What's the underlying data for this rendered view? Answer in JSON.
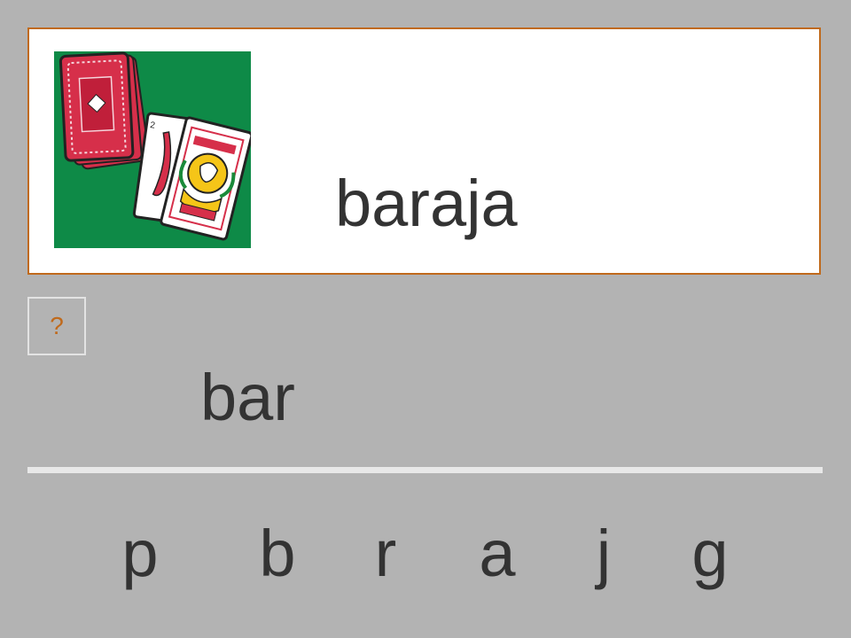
{
  "card": {
    "word": "baraja",
    "image_icon": "spanish-playing-cards-icon"
  },
  "help": {
    "label": "?"
  },
  "answer": {
    "text": "bar"
  },
  "letters": [
    "p",
    "b",
    "r",
    "a",
    "j",
    "g"
  ],
  "colors": {
    "background": "#b3b3b3",
    "card_border": "#c06a1c",
    "text": "#333333",
    "image_bg": "#0e8a47",
    "card_red": "#d62f4a"
  }
}
